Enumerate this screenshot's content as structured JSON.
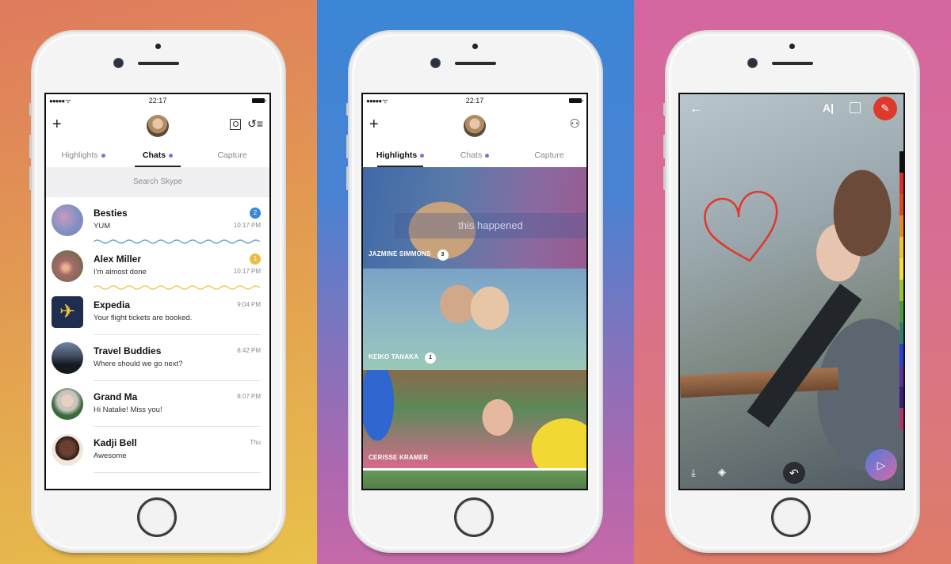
{
  "colors": {
    "accent_purple": "#7a73d4",
    "badge_blue": "#3a86d8",
    "badge_yellow": "#e9be45",
    "brush_red": "#dd3a2c"
  },
  "status_bar": {
    "signal": "●●●●● ᯤ",
    "time": "22:17"
  },
  "icons": {
    "plus": "+",
    "call": "↺≡",
    "add_contact": "⚇",
    "back": "←",
    "text": "A|",
    "brush": "✎",
    "download": "⤓",
    "gem": "◈",
    "undo": "↶",
    "send": "▷"
  },
  "tabs": [
    {
      "label": "Highlights",
      "has_dot": true
    },
    {
      "label": "Chats",
      "has_dot": true
    },
    {
      "label": "Capture",
      "has_dot": false
    }
  ],
  "chats_screen": {
    "active_tab": "Chats",
    "search_placeholder": "Search Skype",
    "conversations": [
      {
        "name": "Besties",
        "message": "YUM",
        "time": "10:17 PM",
        "unread": "2",
        "badge_color": "#3a86d8",
        "divider": "wave-blue"
      },
      {
        "name": "Alex Miller",
        "message": "I'm almost done",
        "time": "10:17 PM",
        "unread": "1",
        "badge_color": "#e9be45",
        "divider": "wave-yellow"
      },
      {
        "name": "Expedia",
        "message": "Your flight tickets are booked.",
        "time": "9:04 PM",
        "unread": "",
        "divider": "line"
      },
      {
        "name": "Travel Buddies",
        "message": "Where should we go next?",
        "time": "8:42 PM",
        "unread": "",
        "divider": "line"
      },
      {
        "name": "Grand Ma",
        "message": "Hi Natalie! Miss you!",
        "time": "8:07 PM",
        "unread": "",
        "divider": "line"
      },
      {
        "name": "Kadji Bell",
        "message": "Awesome",
        "time": "Thu",
        "unread": "",
        "divider": "line"
      }
    ]
  },
  "highlights_screen": {
    "active_tab": "Highlights",
    "items": [
      {
        "name": "JAZMINE SIMMONS",
        "count": "3",
        "caption": "this happened"
      },
      {
        "name": "KEIKO TANAKA",
        "count": "1",
        "caption": ""
      },
      {
        "name": "CERISSE KRAMER",
        "count": "",
        "caption": ""
      }
    ]
  },
  "capture_screen": {
    "palette": [
      "#111111",
      "#d62f24",
      "#d94a22",
      "#e8872a",
      "#f1c232",
      "#f4e03a",
      "#9cc23a",
      "#4c9a3a",
      "#2f7f6e",
      "#2a3fd0",
      "#5b2f9a",
      "#3a1f78",
      "#b0306a"
    ]
  }
}
